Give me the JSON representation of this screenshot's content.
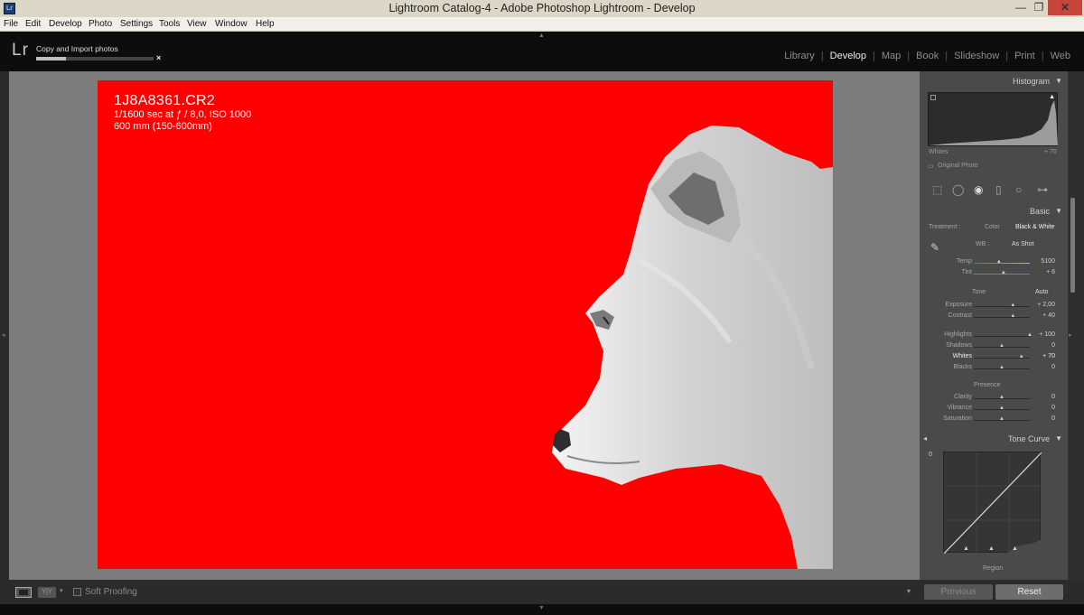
{
  "window": {
    "title": "Lightroom Catalog-4 - Adobe Photoshop Lightroom - Develop",
    "app_icon": "Lr",
    "minimize": "—",
    "maximize": "❐",
    "close": "✕"
  },
  "menu": [
    "File",
    "Edit",
    "Develop",
    "Photo",
    "Settings",
    "Tools",
    "View",
    "Window",
    "Help"
  ],
  "header": {
    "logo": "Lr",
    "task_label": "Copy and Import photos",
    "task_progress": 0.25,
    "task_close": "×",
    "modules": [
      "Library",
      "Develop",
      "Map",
      "Book",
      "Slideshow",
      "Print",
      "Web"
    ],
    "active_module": "Develop"
  },
  "photo_info": {
    "filename": "1J8A8361.CR2",
    "exposure": "1/1600 sec at ƒ / 8,0, ISO 1000",
    "lens": "600 mm (150-600mm)"
  },
  "histogram": {
    "title": "Histogram",
    "readout_label": "Whites",
    "readout_value": "+ 70",
    "original_photo": "Original Photo"
  },
  "basic": {
    "title": "Basic",
    "treatment_label": "Treatment :",
    "treatment_options": [
      "Color",
      "Black & White"
    ],
    "treatment_selected": "Black & White",
    "wb_label": "WB :",
    "wb_value": "As Shot",
    "temp": {
      "label": "Temp",
      "value": "5100",
      "level": 0.45
    },
    "tint": {
      "label": "Tint",
      "value": "+ 6",
      "level": 0.53
    },
    "tone_label": "Tone",
    "auto_label": "Auto",
    "exposure": {
      "label": "Exposure",
      "value": "+ 2,00",
      "level": 0.7
    },
    "contrast": {
      "label": "Contrast",
      "value": "+ 40",
      "level": 0.7
    },
    "highlights": {
      "label": "Highlights",
      "value": "+ 100",
      "level": 1.0
    },
    "shadows": {
      "label": "Shadows",
      "value": "0",
      "level": 0.5
    },
    "whites": {
      "label": "Whites",
      "value": "+ 70",
      "level": 0.85
    },
    "blacks": {
      "label": "Blacks",
      "value": "0",
      "level": 0.5
    },
    "presence_label": "Presence",
    "clarity": {
      "label": "Clarity",
      "value": "0",
      "level": 0.5
    },
    "vibrance": {
      "label": "Vibrance",
      "value": "0",
      "level": 0.5
    },
    "saturation": {
      "label": "Saturation",
      "value": "0",
      "level": 0.5
    }
  },
  "tone_curve": {
    "title": "Tone Curve",
    "corner_label": "0",
    "region_label": "Region"
  },
  "toolbar": {
    "view_label": "Y|Y",
    "soft_proofing": "Soft Proofing"
  },
  "buttons": {
    "previous": "Previous",
    "reset": "Reset"
  },
  "colors": {
    "mask_overlay": "#ff0000",
    "panel_bg": "#4a4a4a",
    "canvas_bg": "#7c7c7c"
  }
}
